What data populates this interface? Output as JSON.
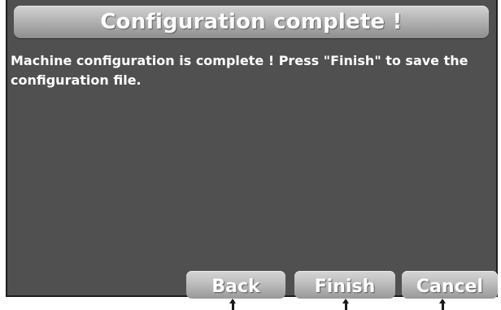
{
  "dialog": {
    "title": "Configuration complete !",
    "message": "Machine configuration is complete ! Press \"Finish\" to save the configuration file."
  },
  "buttons": {
    "back_label": "Back",
    "finish_label": "Finish",
    "cancel_label": "Cancel"
  },
  "colors": {
    "screen_background": "#505050",
    "title_bar": "#b4b4b4",
    "button": "#bdbdbd",
    "text": "#ffffff"
  },
  "icons": [
    "pointer-arrow-icon"
  ]
}
